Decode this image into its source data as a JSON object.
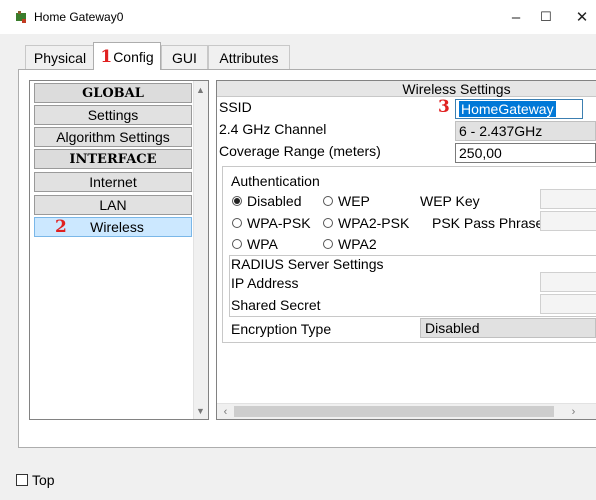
{
  "window": {
    "title": "Home Gateway0",
    "minimize": "–",
    "maximize": "☐",
    "close": "✕"
  },
  "tabs": [
    {
      "label": "Physical"
    },
    {
      "label": "Config",
      "annotation": "1"
    },
    {
      "label": "GUI"
    },
    {
      "label": "Attributes"
    }
  ],
  "sidebar": {
    "items": [
      {
        "label": "GLOBAL",
        "kind": "header"
      },
      {
        "label": "Settings"
      },
      {
        "label": "Algorithm Settings"
      },
      {
        "label": "INTERFACE",
        "kind": "header"
      },
      {
        "label": "Internet"
      },
      {
        "label": "LAN"
      },
      {
        "label": "Wireless",
        "selected": true,
        "annotation": "2"
      }
    ]
  },
  "wireless": {
    "title": "Wireless Settings",
    "ssid_label": "SSID",
    "ssid_value": "HomeGateway",
    "ssid_annotation": "3",
    "channel_label": "2.4 GHz Channel",
    "channel_value": "6 - 2.437GHz",
    "coverage_label": "Coverage Range (meters)",
    "coverage_value": "250,00",
    "auth_label": "Authentication",
    "auth_options": [
      "Disabled",
      "WEP",
      "WPA-PSK",
      "WPA2-PSK",
      "WPA",
      "WPA2"
    ],
    "auth_selected": "Disabled",
    "wep_key_label": "WEP Key",
    "psk_label": "PSK Pass Phrase",
    "radius_label": "RADIUS Server Settings",
    "ip_label": "IP Address",
    "secret_label": "Shared Secret",
    "encryption_label": "Encryption Type",
    "encryption_value": "Disabled"
  },
  "footer": {
    "top_label": "Top"
  }
}
